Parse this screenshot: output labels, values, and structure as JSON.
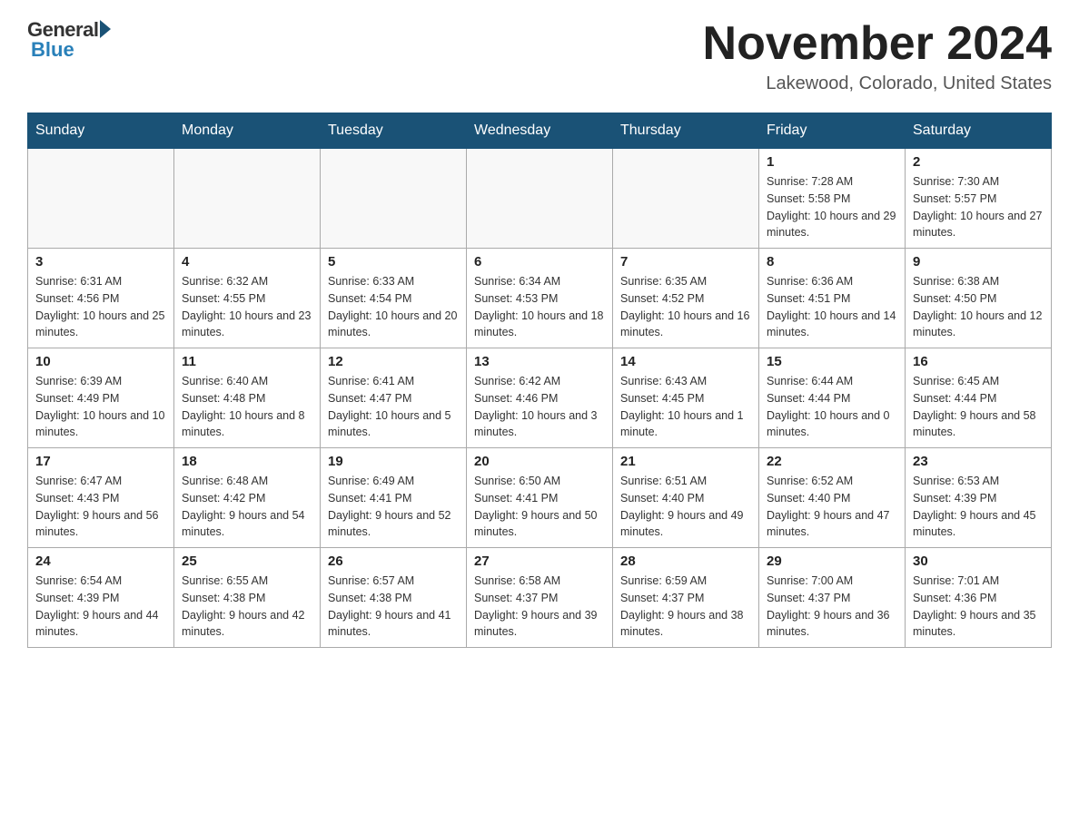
{
  "header": {
    "logo_general": "General",
    "logo_blue": "Blue",
    "title": "November 2024",
    "location": "Lakewood, Colorado, United States"
  },
  "days_of_week": [
    "Sunday",
    "Monday",
    "Tuesday",
    "Wednesday",
    "Thursday",
    "Friday",
    "Saturday"
  ],
  "weeks": [
    [
      {
        "day": "",
        "info": ""
      },
      {
        "day": "",
        "info": ""
      },
      {
        "day": "",
        "info": ""
      },
      {
        "day": "",
        "info": ""
      },
      {
        "day": "",
        "info": ""
      },
      {
        "day": "1",
        "info": "Sunrise: 7:28 AM\nSunset: 5:58 PM\nDaylight: 10 hours and 29 minutes."
      },
      {
        "day": "2",
        "info": "Sunrise: 7:30 AM\nSunset: 5:57 PM\nDaylight: 10 hours and 27 minutes."
      }
    ],
    [
      {
        "day": "3",
        "info": "Sunrise: 6:31 AM\nSunset: 4:56 PM\nDaylight: 10 hours and 25 minutes."
      },
      {
        "day": "4",
        "info": "Sunrise: 6:32 AM\nSunset: 4:55 PM\nDaylight: 10 hours and 23 minutes."
      },
      {
        "day": "5",
        "info": "Sunrise: 6:33 AM\nSunset: 4:54 PM\nDaylight: 10 hours and 20 minutes."
      },
      {
        "day": "6",
        "info": "Sunrise: 6:34 AM\nSunset: 4:53 PM\nDaylight: 10 hours and 18 minutes."
      },
      {
        "day": "7",
        "info": "Sunrise: 6:35 AM\nSunset: 4:52 PM\nDaylight: 10 hours and 16 minutes."
      },
      {
        "day": "8",
        "info": "Sunrise: 6:36 AM\nSunset: 4:51 PM\nDaylight: 10 hours and 14 minutes."
      },
      {
        "day": "9",
        "info": "Sunrise: 6:38 AM\nSunset: 4:50 PM\nDaylight: 10 hours and 12 minutes."
      }
    ],
    [
      {
        "day": "10",
        "info": "Sunrise: 6:39 AM\nSunset: 4:49 PM\nDaylight: 10 hours and 10 minutes."
      },
      {
        "day": "11",
        "info": "Sunrise: 6:40 AM\nSunset: 4:48 PM\nDaylight: 10 hours and 8 minutes."
      },
      {
        "day": "12",
        "info": "Sunrise: 6:41 AM\nSunset: 4:47 PM\nDaylight: 10 hours and 5 minutes."
      },
      {
        "day": "13",
        "info": "Sunrise: 6:42 AM\nSunset: 4:46 PM\nDaylight: 10 hours and 3 minutes."
      },
      {
        "day": "14",
        "info": "Sunrise: 6:43 AM\nSunset: 4:45 PM\nDaylight: 10 hours and 1 minute."
      },
      {
        "day": "15",
        "info": "Sunrise: 6:44 AM\nSunset: 4:44 PM\nDaylight: 10 hours and 0 minutes."
      },
      {
        "day": "16",
        "info": "Sunrise: 6:45 AM\nSunset: 4:44 PM\nDaylight: 9 hours and 58 minutes."
      }
    ],
    [
      {
        "day": "17",
        "info": "Sunrise: 6:47 AM\nSunset: 4:43 PM\nDaylight: 9 hours and 56 minutes."
      },
      {
        "day": "18",
        "info": "Sunrise: 6:48 AM\nSunset: 4:42 PM\nDaylight: 9 hours and 54 minutes."
      },
      {
        "day": "19",
        "info": "Sunrise: 6:49 AM\nSunset: 4:41 PM\nDaylight: 9 hours and 52 minutes."
      },
      {
        "day": "20",
        "info": "Sunrise: 6:50 AM\nSunset: 4:41 PM\nDaylight: 9 hours and 50 minutes."
      },
      {
        "day": "21",
        "info": "Sunrise: 6:51 AM\nSunset: 4:40 PM\nDaylight: 9 hours and 49 minutes."
      },
      {
        "day": "22",
        "info": "Sunrise: 6:52 AM\nSunset: 4:40 PM\nDaylight: 9 hours and 47 minutes."
      },
      {
        "day": "23",
        "info": "Sunrise: 6:53 AM\nSunset: 4:39 PM\nDaylight: 9 hours and 45 minutes."
      }
    ],
    [
      {
        "day": "24",
        "info": "Sunrise: 6:54 AM\nSunset: 4:39 PM\nDaylight: 9 hours and 44 minutes."
      },
      {
        "day": "25",
        "info": "Sunrise: 6:55 AM\nSunset: 4:38 PM\nDaylight: 9 hours and 42 minutes."
      },
      {
        "day": "26",
        "info": "Sunrise: 6:57 AM\nSunset: 4:38 PM\nDaylight: 9 hours and 41 minutes."
      },
      {
        "day": "27",
        "info": "Sunrise: 6:58 AM\nSunset: 4:37 PM\nDaylight: 9 hours and 39 minutes."
      },
      {
        "day": "28",
        "info": "Sunrise: 6:59 AM\nSunset: 4:37 PM\nDaylight: 9 hours and 38 minutes."
      },
      {
        "day": "29",
        "info": "Sunrise: 7:00 AM\nSunset: 4:37 PM\nDaylight: 9 hours and 36 minutes."
      },
      {
        "day": "30",
        "info": "Sunrise: 7:01 AM\nSunset: 4:36 PM\nDaylight: 9 hours and 35 minutes."
      }
    ]
  ]
}
